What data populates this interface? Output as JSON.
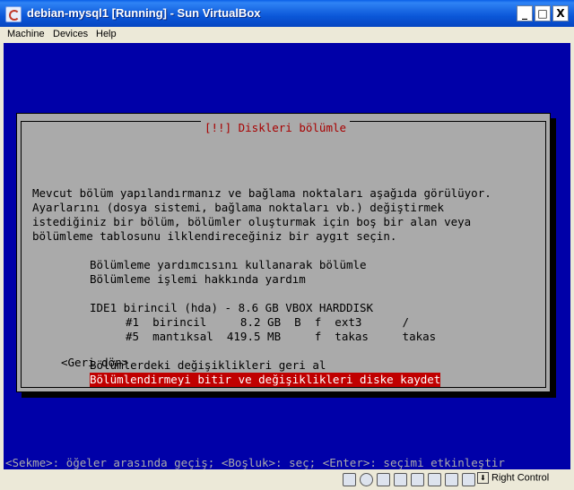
{
  "window": {
    "title": "debian-mysql1 [Running] - Sun VirtualBox",
    "minimize_glyph": "_",
    "maximize_glyph": "□",
    "close_glyph": "X"
  },
  "menubar": {
    "items": [
      "Machine",
      "Devices",
      "Help"
    ]
  },
  "installer": {
    "dialog_title": "[!!] Diskleri bölümle",
    "description": [
      "Mevcut bölüm yapılandırmanız ve bağlama noktaları aşağıda görülüyor.",
      "Ayarlarını (dosya sistemi, bağlama noktaları vb.) değiştirmek",
      "istediğiniz bir bölüm, bölümler oluşturmak için boş bir alan veya",
      "bölümleme tablosunu ilklendireceğiniz bir aygıt seçin."
    ],
    "options": {
      "guided": "Bölümleme yardımcısını kullanarak bölümle",
      "help": "Bölümleme işlemi hakkında yardım"
    },
    "disk": {
      "label": "IDE1 birincil (hda) - 8.6 GB VBOX HARDDISK",
      "partitions": [
        "#1  birincil     8.2 GB  B  f  ext3      /",
        "#5  mantıksal  419.5 MB     f  takas     takas"
      ]
    },
    "actions": {
      "undo": "Bölümlerdeki değişiklikleri geri al",
      "finish": "Bölümlendirmeyi bitir ve değişiklikleri diske kaydet"
    },
    "back": "<Geri dön>",
    "status_line": "<Sekme>: öğeler arasında geçiş; <Boşluk>: seç; <Enter>: seçimi etkinleştir"
  },
  "statusbar": {
    "icons": [
      "hard-disk-icon",
      "cd-icon",
      "floppy-icon",
      "usb-icon",
      "network-icon",
      "shared-folder-icon",
      "display-icon",
      "capture-icon"
    ],
    "host_key": "Right Control"
  },
  "colors": {
    "screen_bg": "#0000a8",
    "dialog_bg": "#aaaaaa",
    "title_red": "#a80000",
    "highlight": "#c00000",
    "xp_blue": "#0b57d8"
  }
}
